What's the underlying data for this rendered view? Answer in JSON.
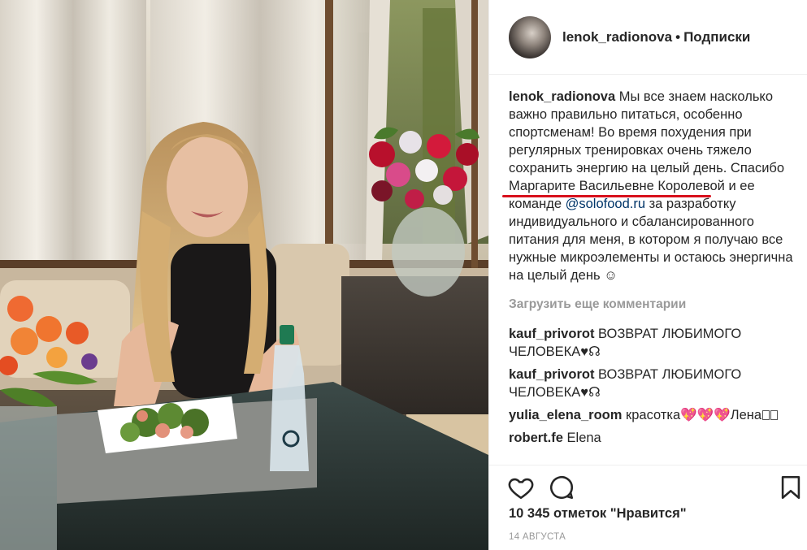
{
  "post": {
    "username": "lenok_radionova",
    "separator": "•",
    "follow_label": "Подписки"
  },
  "caption": {
    "username": "lenok_radionova",
    "text_1": "Мы все знаем насколько важно правильно питаться, особенно спортсменам! Во время похудения при регулярных тренировках очень тяжело сохранить энергию на целый день. Спасибо ",
    "mention_name": "Маргарите Васильевне",
    "text_2": " Королевой и ее команде ",
    "mention_link": "@solofood.ru",
    "text_3": " за разработку индивидуального и сбалансированного питания для меня, в котором я получаю все нужные микроэлементы и остаюсь энергична на целый день ☺"
  },
  "load_more_label": "Загрузить еще комментарии",
  "comments": [
    {
      "username": "kauf_privorot",
      "text": "ВОЗВРАТ ЛЮБИМОГО ЧЕЛОВЕКА♥☊"
    },
    {
      "username": "kauf_privorot",
      "text": "ВОЗВРАТ ЛЮБИМОГО ЧЕЛОВЕКА♥☊"
    },
    {
      "username": "yulia_elena_room",
      "text": "красотка💖💖💖Лена"
    },
    {
      "username": "robert.fe",
      "text": "Elena"
    }
  ],
  "likes_text": "10 345 отметок \"Нравится\"",
  "date_text": "14 АВГУСТА",
  "icons": {
    "like": "heart-icon",
    "comment": "comment-bubble-icon",
    "save": "bookmark-icon"
  },
  "colors": {
    "link": "#003569",
    "muted": "#999999",
    "annotation_underline": "#d8101c"
  }
}
